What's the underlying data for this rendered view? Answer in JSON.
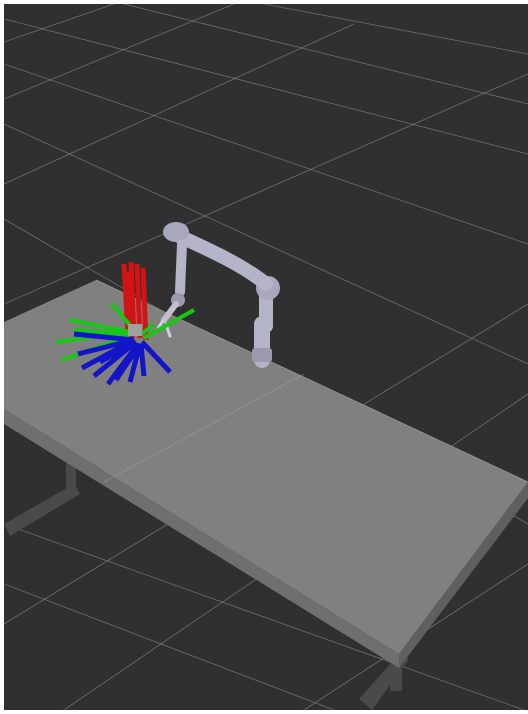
{
  "viewport": {
    "background_color": "#303030",
    "grid_color": "#a0a0a0"
  },
  "scene": {
    "table": {
      "top_color": "#808080",
      "edge_color": "#6a6a6a",
      "leg_color": "#4a4a4a"
    },
    "robot_arm": {
      "link_color": "#b4b4c8",
      "joint_color": "#9a9aae"
    },
    "axis_markers": {
      "x_color": "#d21414",
      "y_color": "#14c814",
      "z_color": "#1414c8"
    }
  }
}
